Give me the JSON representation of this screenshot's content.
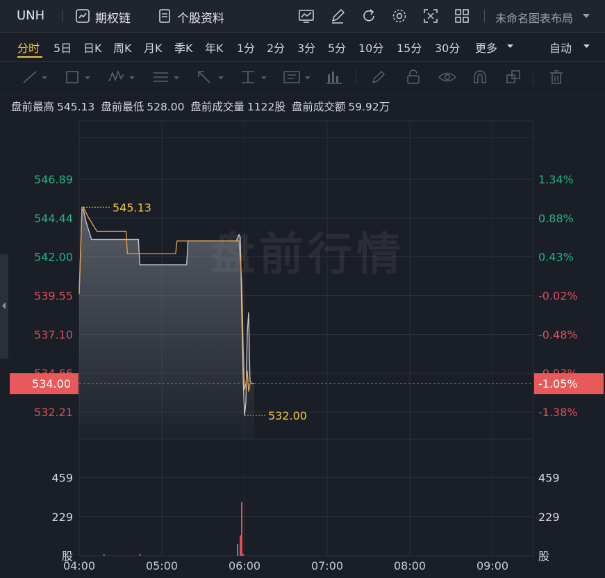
{
  "topbar": {
    "symbol": "UNH",
    "options_chain": "期权链",
    "stock_profile": "个股资料",
    "layout_name": "未命名图表布局"
  },
  "periods": {
    "items": [
      "分时",
      "5日",
      "日K",
      "周K",
      "月K",
      "季K",
      "年K",
      "1分",
      "2分",
      "3分",
      "5分",
      "10分",
      "15分",
      "30分",
      "更多"
    ],
    "active": "分时",
    "auto_label": "自动"
  },
  "info": {
    "high_label": "盘前最高",
    "high_value": "545.13",
    "low_label": "盘前最低",
    "low_value": "528.00",
    "volume_label": "盘前成交量",
    "volume_value": "1122股",
    "amount_label": "盘前成交额",
    "amount_value": "59.92万"
  },
  "watermark": "盘前行情",
  "colors": {
    "up": "#24b47e",
    "down": "#e0505a",
    "accent": "#f4c542",
    "price_line": "#e8a44a",
    "avg_line": "#c9ccd2",
    "current_tag": "#e85a5a"
  },
  "chart_data": {
    "type": "line",
    "price_axis_left": [
      "546.89",
      "544.44",
      "542.00",
      "539.55",
      "537.10",
      "534.66",
      "532.21"
    ],
    "pct_axis_right": [
      "1.34%",
      "0.88%",
      "0.43%",
      "-0.02%",
      "-0.48%",
      "-0.93%",
      "-1.38%"
    ],
    "reference_price": 539.66,
    "current_price": "534.00",
    "current_pct": "-1.05%",
    "high_annotation": "545.13",
    "low_annotation": "532.00",
    "time_labels": [
      "04:00",
      "05:00",
      "06:00",
      "07:00",
      "08:00",
      "09:00"
    ],
    "volume_axis": [
      "459",
      "229",
      "股"
    ],
    "price_series": {
      "times": [
        0,
        2,
        3,
        7,
        13,
        34,
        35,
        70,
        71,
        116,
        118,
        119,
        120,
        121,
        122,
        123,
        124,
        125,
        126,
        127
      ],
      "values": [
        539.66,
        545.13,
        545.13,
        544.44,
        543.6,
        543.6,
        542.2,
        542.2,
        543.0,
        543.0,
        540.5,
        536.5,
        533.6,
        534.0,
        534.8,
        533.5,
        534.0,
        534.0,
        534.0,
        534.0
      ]
    },
    "avg_series": {
      "times": [
        0,
        2,
        3,
        5,
        9,
        18,
        43,
        44,
        78,
        79,
        114,
        116,
        117,
        118,
        119,
        120,
        121,
        122,
        123,
        124,
        125,
        126,
        127
      ],
      "values": [
        539.66,
        545.0,
        545.0,
        544.2,
        543.1,
        543.1,
        543.1,
        541.5,
        541.5,
        543.0,
        543.0,
        543.4,
        543.2,
        538.5,
        534.4,
        532.0,
        532.8,
        537.2,
        538.5,
        534.2,
        534.0,
        534.0,
        534.0
      ]
    },
    "volume_bars": [
      {
        "t": 18,
        "v": 8,
        "dir": "up"
      },
      {
        "t": 44,
        "v": 10,
        "dir": "down"
      },
      {
        "t": 115,
        "v": 68,
        "dir": "up"
      },
      {
        "t": 117,
        "v": 120,
        "dir": "down"
      },
      {
        "t": 118,
        "v": 315,
        "dir": "down"
      },
      {
        "t": 119,
        "v": 10,
        "dir": "down"
      }
    ]
  }
}
